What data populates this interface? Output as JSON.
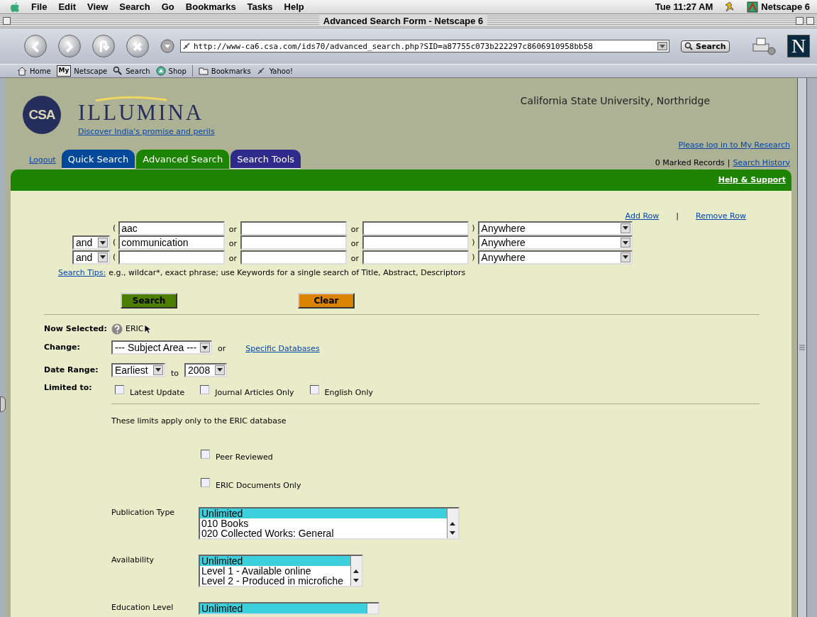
{
  "menubar": {
    "menus": [
      "File",
      "Edit",
      "View",
      "Search",
      "Go",
      "Bookmarks",
      "Tasks",
      "Help"
    ],
    "clock": "Tue 11:27 AM",
    "app": "Netscape 6"
  },
  "window": {
    "title": "Advanced Search Form - Netscape 6"
  },
  "toolbar": {
    "url": "http://www-ca6.csa.com/ids70/advanced_search.php?SID=a87755c073b222297c8606910958bb58",
    "search_button": "Search",
    "logo_letter": "N"
  },
  "personal_toolbar": [
    {
      "kind": "home",
      "label": "Home"
    },
    {
      "kind": "my",
      "badge": "My",
      "label": "Netscape"
    },
    {
      "kind": "search",
      "label": "Search"
    },
    {
      "kind": "shop",
      "label": "Shop"
    },
    {
      "kind": "folder",
      "label": "Bookmarks"
    },
    {
      "kind": "link",
      "label": "Yahoo!"
    }
  ],
  "header": {
    "logo_text": "CSA",
    "brand": "ILLUMINA",
    "promo_link": "Discover India's promise and perils",
    "institution": "California State University, Northridge",
    "login_link": "Please log in to My Research",
    "marked_records": "0 Marked Records",
    "separator": "|",
    "history_link": "Search History",
    "logout": "Logout",
    "tabs": [
      {
        "label": "Quick Search",
        "selected": false,
        "color": "#00489a"
      },
      {
        "label": "Advanced Search",
        "selected": true,
        "color": "#1c8400"
      },
      {
        "label": "Search Tools",
        "selected": false,
        "color": "#302a8a"
      }
    ],
    "help_link": "Help & Support"
  },
  "search": {
    "add_row": "Add Row",
    "separator": "|",
    "remove_row": "Remove Row",
    "rows": [
      {
        "open": "(",
        "values": [
          "aac"
        ],
        "joiners": [
          "or",
          "or"
        ],
        "close": ")",
        "scope": "Anywhere"
      },
      {
        "operator": "and",
        "open": "(",
        "values": [
          "communication"
        ],
        "joiners": [
          "or",
          "or"
        ],
        "close": ")",
        "scope": "Anywhere"
      },
      {
        "operator": "and",
        "open": "(",
        "joiners": [
          "or",
          "or"
        ],
        "close": ")",
        "scope": "Anywhere"
      }
    ],
    "tips_link": "Search Tips:",
    "tips_text": "e.g., wildcar*, exact phrase; use Keywords for a single search of Title, Abstract, Descriptors",
    "search_button": "Search",
    "clear_button": "Clear"
  },
  "limits": {
    "now_selected_label": "Now Selected:",
    "now_selected": "ERIC",
    "change_label": "Change:",
    "subject_area": "--- Subject Area ---",
    "or": "or",
    "databases_link": "Specific Databases",
    "date_label": "Date Range:",
    "date_from": "Earliest",
    "to": "to",
    "date_to": "2008",
    "limited_label": "Limited to:",
    "checkboxes": [
      {
        "label": "Latest Update",
        "checked": false
      },
      {
        "label": "Journal Articles Only",
        "checked": false
      },
      {
        "label": "English Only",
        "checked": false
      }
    ],
    "eric_note": "These limits apply only to the ERIC database",
    "eric_checkboxes": [
      {
        "label": "Peer Reviewed",
        "checked": false
      },
      {
        "label": "ERIC Documents Only",
        "checked": false
      }
    ],
    "listboxes": [
      {
        "label": "Publication Type",
        "options": [
          {
            "text": "Unlimited",
            "selected": true
          },
          {
            "text": "010 Books",
            "selected": false
          },
          {
            "text": "020 Collected Works: General",
            "selected": false
          }
        ]
      },
      {
        "label": "Availability",
        "options": [
          {
            "text": "Unlimited",
            "selected": true
          },
          {
            "text": "Level 1 - Available online",
            "selected": false
          },
          {
            "text": "Level 2 - Produced in microfiche",
            "selected": false
          }
        ]
      },
      {
        "label": "Education Level",
        "options": [
          {
            "text": "Unlimited",
            "selected": true
          }
        ]
      }
    ]
  }
}
